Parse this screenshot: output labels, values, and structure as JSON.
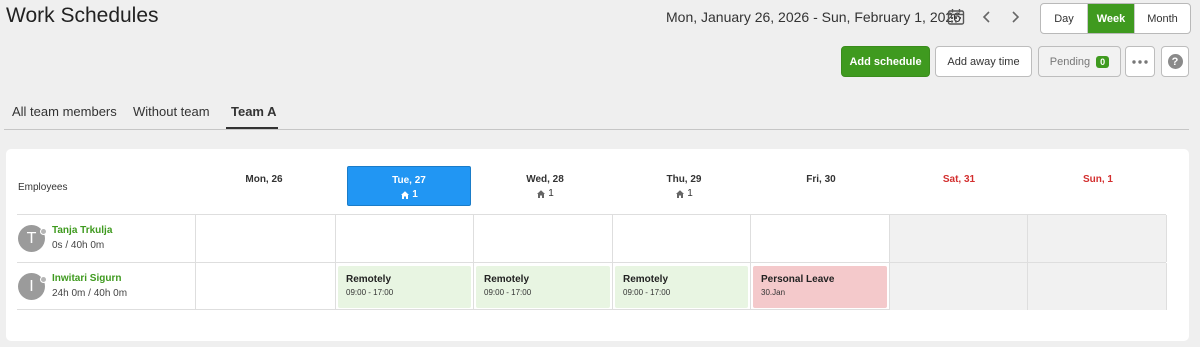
{
  "page": {
    "title": "Work Schedules"
  },
  "toolbar": {
    "date_range": "Mon, January 26, 2026 - Sun, February 1, 2026",
    "views": [
      "Day",
      "Week",
      "Month"
    ],
    "active_view": "Week",
    "add_schedule": "Add schedule",
    "add_away_time": "Add away time",
    "pending_label": "Pending",
    "pending_count": "0",
    "help": "?"
  },
  "tabs": [
    "All team members",
    "Without team",
    "Team A"
  ],
  "active_tab": "Team A",
  "grid": {
    "employees_header": "Employees",
    "days": [
      {
        "label": "Mon, 26",
        "weekend": false,
        "today": false,
        "remote_count": ""
      },
      {
        "label": "Tue, 27",
        "weekend": false,
        "today": true,
        "remote_count": "1"
      },
      {
        "label": "Wed, 28",
        "weekend": false,
        "today": false,
        "remote_count": "1"
      },
      {
        "label": "Thu, 29",
        "weekend": false,
        "today": false,
        "remote_count": "1"
      },
      {
        "label": "Fri, 30",
        "weekend": false,
        "today": false,
        "remote_count": ""
      },
      {
        "label": "Sat, 31",
        "weekend": true,
        "today": false,
        "remote_count": ""
      },
      {
        "label": "Sun, 1",
        "weekend": true,
        "today": false,
        "remote_count": ""
      }
    ],
    "employees": [
      {
        "initial": "T",
        "name": "Tanja Trkulja",
        "hours": "0s / 40h 0m",
        "shifts": [
          null,
          null,
          null,
          null,
          null,
          null,
          null
        ]
      },
      {
        "initial": "I",
        "name": "Inwitari Sigurn",
        "hours": "24h 0m / 40h 0m",
        "shifts": [
          null,
          {
            "kind": "remote",
            "title": "Remotely",
            "time": "09:00 - 17:00"
          },
          {
            "kind": "remote",
            "title": "Remotely",
            "time": "09:00 - 17:00"
          },
          {
            "kind": "remote",
            "title": "Remotely",
            "time": "09:00 - 17:00"
          },
          {
            "kind": "leave",
            "title": "Personal Leave",
            "time": "30.Jan"
          },
          null,
          null
        ]
      }
    ]
  },
  "colors": {
    "accent_green": "#3f9a1f",
    "today_blue": "#2196f3",
    "weekend_red": "#d32f2f",
    "remote_bg": "#e8f5e2",
    "leave_bg": "#f4c9cb"
  }
}
